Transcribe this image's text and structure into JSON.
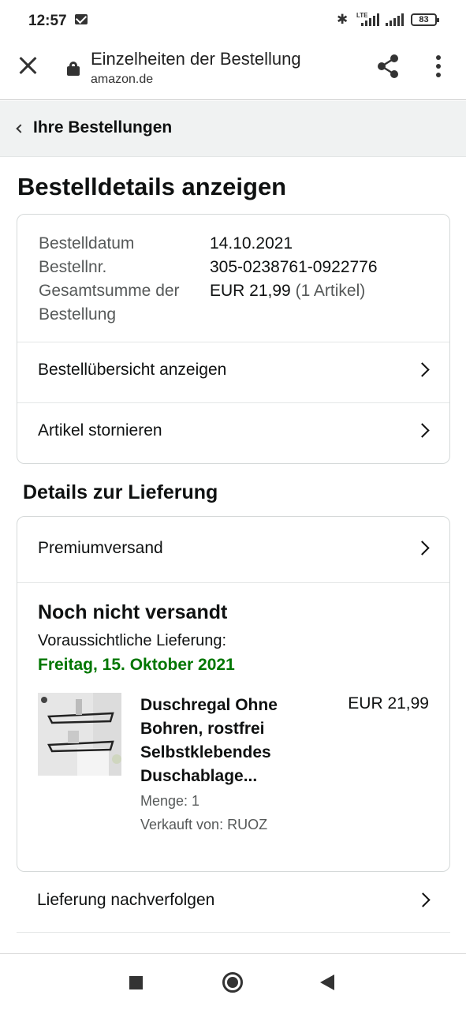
{
  "status_bar": {
    "time": "12:57",
    "network": "LTE",
    "battery": "83",
    "icons": [
      "mail-icon",
      "bluetooth-icon",
      "signal-icon",
      "battery-icon"
    ]
  },
  "browser": {
    "title": "Einzelheiten der Bestellung",
    "url": "amazon.de"
  },
  "breadcrumb": {
    "label": "Ihre Bestellungen"
  },
  "page": {
    "heading": "Bestelldetails anzeigen"
  },
  "order": {
    "rows": [
      {
        "key": "Bestelldatum",
        "value": "14.10.2021"
      },
      {
        "key": "Bestellnr.",
        "value": "305-0238761-0922776"
      },
      {
        "key": "Gesamtsumme der Bestellung",
        "value": "EUR 21,99",
        "value_sub": "(1 Artikel)"
      }
    ],
    "links": [
      {
        "label": "Bestellübersicht anzeigen"
      },
      {
        "label": "Artikel stornieren"
      }
    ]
  },
  "delivery": {
    "heading": "Details zur Lieferung",
    "method": "Premiumversand",
    "status": "Noch nicht versandt",
    "expected_label": "Voraussichtliche Lieferung:",
    "expected_date": "Freitag, 15. Oktober 2021",
    "product": {
      "title": "Duschregal Ohne Bohren, rostfrei Selbstklebendes Duschablage...",
      "price": "EUR 21,99",
      "quantity": "Menge: 1",
      "seller": "Verkauft von: RUOZ"
    },
    "track_label": "Lieferung nachverfolgen"
  },
  "colors": {
    "green_date": "#007600",
    "secondary_text": "#565959",
    "border": "#d5d9d9"
  }
}
